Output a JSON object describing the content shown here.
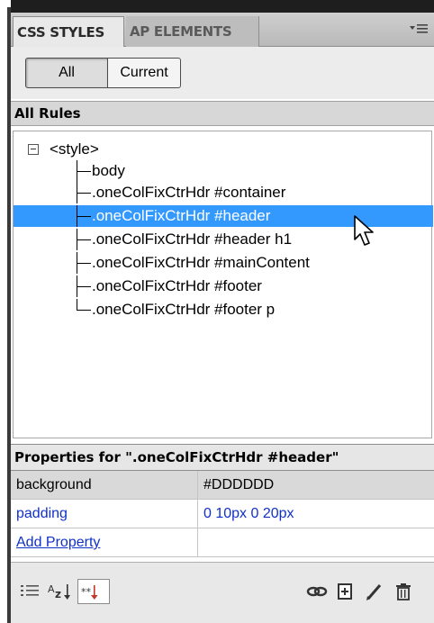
{
  "tabs": [
    {
      "label": "CSS STYLES"
    },
    {
      "label": "AP ELEMENTS"
    }
  ],
  "panel_menu_icon": "panel-options-icon",
  "toggle": {
    "all": "All",
    "current": "Current",
    "selected": "All"
  },
  "all_rules": {
    "title": "All Rules",
    "root": "<style>",
    "rules": [
      {
        "label": "body"
      },
      {
        "label": ".oneColFixCtrHdr #container"
      },
      {
        "label": ".oneColFixCtrHdr #header",
        "selected": true
      },
      {
        "label": ".oneColFixCtrHdr #header h1"
      },
      {
        "label": ".oneColFixCtrHdr #mainContent"
      },
      {
        "label": ".oneColFixCtrHdr #footer"
      },
      {
        "label": ".oneColFixCtrHdr #footer p"
      }
    ]
  },
  "properties": {
    "title": "Properties for \".oneColFixCtrHdr #header\"",
    "rows": [
      {
        "name": "background",
        "value": "#DDDDDD"
      },
      {
        "name": "padding",
        "value": "0 10px 0 20px"
      }
    ],
    "add_property": "Add Property"
  },
  "toolbar": {
    "left_icons": [
      "category-view-icon",
      "alphabetical-view-icon",
      "set-properties-view-icon"
    ],
    "right_icons": [
      "attach-stylesheet-icon",
      "new-css-rule-icon",
      "edit-style-icon",
      "delete-css-rule-icon"
    ]
  },
  "colors": {
    "selection": "#3399ff",
    "link": "#1030c8"
  }
}
